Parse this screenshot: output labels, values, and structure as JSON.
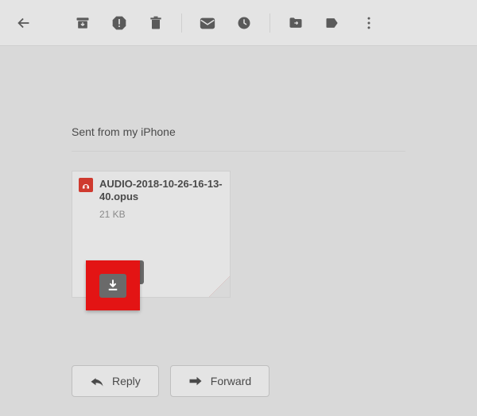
{
  "body": {
    "signature": "Sent from my iPhone"
  },
  "attachment": {
    "filename": "AUDIO-2018-10-26-16-13-40.opus",
    "size": "21 KB"
  },
  "actions": {
    "reply": "Reply",
    "forward": "Forward"
  }
}
